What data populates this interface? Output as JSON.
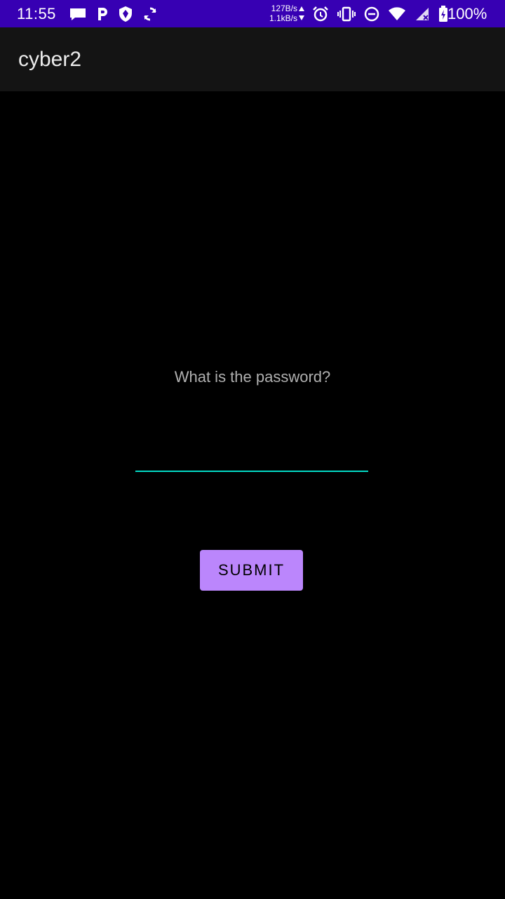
{
  "status_bar": {
    "time": "11:55",
    "net_up": "127B/s",
    "net_down": "1.1kB/s",
    "battery": "100%",
    "background_color": "#3700b3",
    "left_icons": [
      "notification-message-icon",
      "p-app-icon",
      "vpn-shield-icon",
      "sync-icon"
    ],
    "right_icons": [
      "alarm-icon",
      "vibrate-icon",
      "do-not-disturb-icon",
      "wifi-icon",
      "no-signal-icon",
      "battery-charging-icon"
    ]
  },
  "app_bar": {
    "title": "cyber2",
    "background_color": "#141414"
  },
  "main": {
    "prompt": "What is the password?",
    "password_value": "",
    "submit_label": "SUBMIT",
    "accent_color": "#03dac5",
    "button_color": "#bb86fc"
  }
}
